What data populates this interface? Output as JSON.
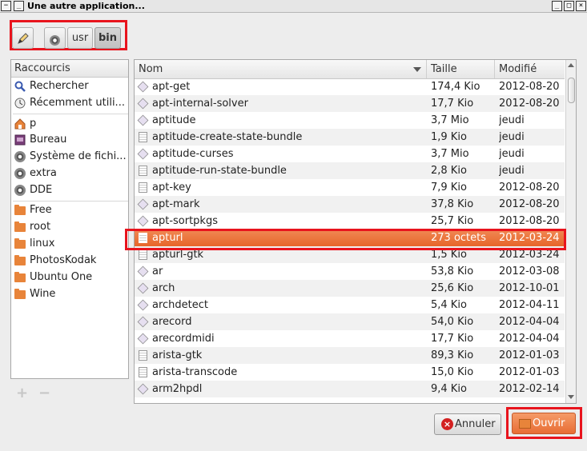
{
  "window": {
    "title": "Une autre application...",
    "controls": {
      "menu": "−",
      "minimize": "_",
      "maximize": "□",
      "close": "×"
    }
  },
  "pathbar": {
    "edit_icon": "pencil-icon",
    "segments": [
      {
        "label": "",
        "icon": "disk-icon"
      },
      {
        "label": "usr"
      },
      {
        "label": "bin",
        "active": true
      }
    ]
  },
  "sidebar": {
    "header": "Raccourcis",
    "groups": [
      [
        {
          "label": "Rechercher",
          "icon": "search-icon"
        },
        {
          "label": "Récemment utili...",
          "icon": "clock-icon"
        }
      ],
      [
        {
          "label": "p",
          "icon": "home-icon"
        },
        {
          "label": "Bureau",
          "icon": "desktop-icon"
        },
        {
          "label": "Système de fichi...",
          "icon": "disk-icon"
        },
        {
          "label": "extra",
          "icon": "disk-icon"
        },
        {
          "label": "DDE",
          "icon": "disk-icon"
        }
      ],
      [
        {
          "label": "Free",
          "icon": "folder-icon"
        },
        {
          "label": "root",
          "icon": "folder-icon"
        },
        {
          "label": "linux",
          "icon": "folder-icon"
        },
        {
          "label": "PhotosKodak",
          "icon": "folder-icon"
        },
        {
          "label": "Ubuntu One",
          "icon": "folder-icon"
        },
        {
          "label": "Wine",
          "icon": "folder-icon"
        }
      ]
    ],
    "add_label": "+",
    "remove_label": "−"
  },
  "filelist": {
    "columns": {
      "name": "Nom",
      "size": "Taille",
      "modified": "Modifié"
    },
    "rows": [
      {
        "name": "apt-get",
        "size": "174,4 Kio",
        "modified": "2012-08-20",
        "type": "exec"
      },
      {
        "name": "apt-internal-solver",
        "size": "17,7 Kio",
        "modified": "2012-08-20",
        "type": "exec"
      },
      {
        "name": "aptitude",
        "size": "3,7 Mio",
        "modified": "jeudi",
        "type": "exec"
      },
      {
        "name": "aptitude-create-state-bundle",
        "size": "1,9 Kio",
        "modified": "jeudi",
        "type": "doc"
      },
      {
        "name": "aptitude-curses",
        "size": "3,7 Mio",
        "modified": "jeudi",
        "type": "exec"
      },
      {
        "name": "aptitude-run-state-bundle",
        "size": "2,8 Kio",
        "modified": "jeudi",
        "type": "doc"
      },
      {
        "name": "apt-key",
        "size": "7,9 Kio",
        "modified": "2012-08-20",
        "type": "doc"
      },
      {
        "name": "apt-mark",
        "size": "37,8 Kio",
        "modified": "2012-08-20",
        "type": "exec"
      },
      {
        "name": "apt-sortpkgs",
        "size": "25,7 Kio",
        "modified": "2012-08-20",
        "type": "exec"
      },
      {
        "name": "apturl",
        "size": "273 octets",
        "modified": "2012-03-24",
        "type": "doc",
        "selected": true
      },
      {
        "name": "apturl-gtk",
        "size": "1,5 Kio",
        "modified": "2012-03-24",
        "type": "doc"
      },
      {
        "name": "ar",
        "size": "53,8 Kio",
        "modified": "2012-03-08",
        "type": "exec"
      },
      {
        "name": "arch",
        "size": "25,6 Kio",
        "modified": "2012-10-01",
        "type": "exec"
      },
      {
        "name": "archdetect",
        "size": "5,4 Kio",
        "modified": "2012-04-11",
        "type": "exec"
      },
      {
        "name": "arecord",
        "size": "54,0 Kio",
        "modified": "2012-04-04",
        "type": "exec"
      },
      {
        "name": "arecordmidi",
        "size": "17,7 Kio",
        "modified": "2012-04-04",
        "type": "exec"
      },
      {
        "name": "arista-gtk",
        "size": "89,3 Kio",
        "modified": "2012-01-03",
        "type": "doc"
      },
      {
        "name": "arista-transcode",
        "size": "15,0 Kio",
        "modified": "2012-01-03",
        "type": "doc"
      },
      {
        "name": "arm2hpdl",
        "size": "9,4 Kio",
        "modified": "2012-02-14",
        "type": "exec"
      }
    ]
  },
  "actions": {
    "cancel_label": "Annuler",
    "open_label": "Ouvrir"
  }
}
